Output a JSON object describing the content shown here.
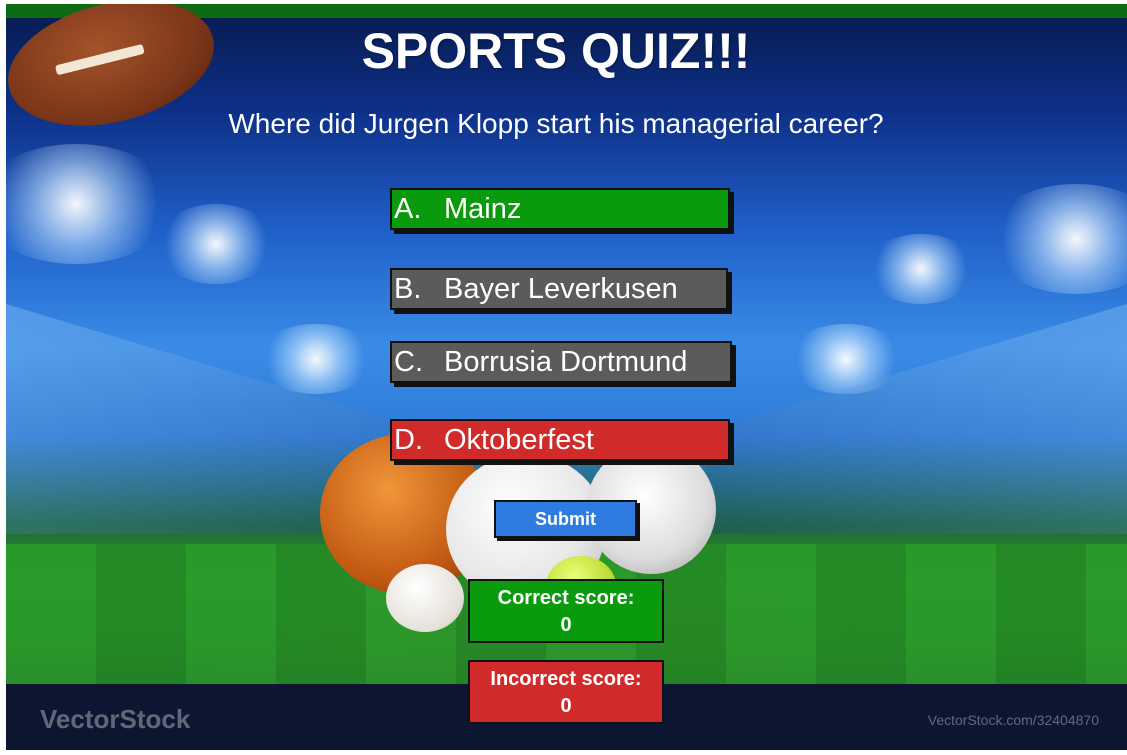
{
  "quiz": {
    "title": "SPORTS QUIZ!!!",
    "question": "Where did Jurgen Klopp start his managerial career?"
  },
  "answers": [
    {
      "letter": "A.",
      "text": "Mainz",
      "color": "#0a9a0e"
    },
    {
      "letter": "B.",
      "text": "Bayer Leverkusen",
      "color": "#5b5b5b"
    },
    {
      "letter": "C.",
      "text": "Borrusia Dortmund",
      "color": "#5b5b5b"
    },
    {
      "letter": "D.",
      "text": "Oktoberfest",
      "color": "#d12a2a"
    }
  ],
  "submit": {
    "label": "Submit",
    "color": "#2f7be0"
  },
  "scores": {
    "correct_label": "Correct score:",
    "correct_value": "0",
    "incorrect_label": "Incorrect score:",
    "incorrect_value": "0"
  },
  "background": {
    "watermark_left": "VectorStock",
    "watermark_right": "VectorStock.com/32404870"
  }
}
